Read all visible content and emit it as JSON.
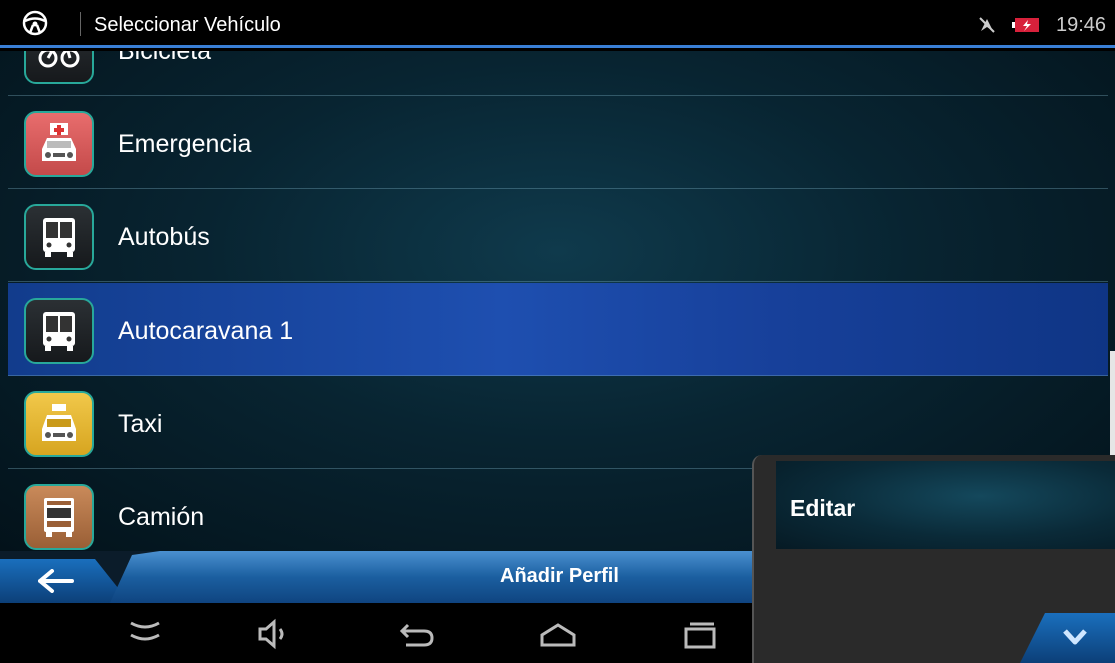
{
  "status_bar": {
    "title": "Seleccionar Vehículo",
    "time": "19:46",
    "icons": [
      "steering-wheel-icon",
      "gps-off-icon",
      "battery-charging-icon"
    ]
  },
  "vehicle_list": {
    "items": [
      {
        "label": "Bicicleta",
        "icon": "bicycle-icon",
        "selected": false
      },
      {
        "label": "Emergencia",
        "icon": "ambulance-icon",
        "selected": false
      },
      {
        "label": "Autobús",
        "icon": "bus-icon",
        "selected": false
      },
      {
        "label": "Autocaravana 1",
        "icon": "motorhome-icon",
        "selected": true
      },
      {
        "label": "Taxi",
        "icon": "taxi-icon",
        "selected": false
      },
      {
        "label": "Camión",
        "icon": "truck-icon",
        "selected": false
      }
    ]
  },
  "action_bar": {
    "back_icon": "back-arrow-icon",
    "add_profile_label": "Añadir Perfil"
  },
  "context_menu": {
    "items": [
      {
        "label": "Editar"
      }
    ],
    "more_icon": "chevron-down-icon"
  },
  "nav_bar": {
    "icons": [
      "hide-keyboard-icon",
      "volume-icon",
      "back-icon",
      "home-icon",
      "recent-apps-icon"
    ]
  },
  "colors": {
    "accent": "#3a7fd6",
    "selected_row": "#1e4fb0",
    "icon_border": "#28a89a"
  }
}
